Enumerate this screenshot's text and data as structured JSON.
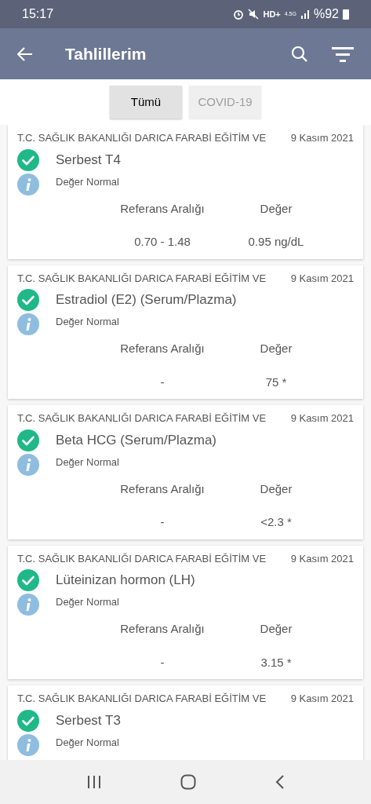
{
  "status_bar": {
    "time": "15:17",
    "network": "HD+",
    "network_gen": "4.5G",
    "battery": "%92"
  },
  "app_bar": {
    "title": "Tahlillerim"
  },
  "tabs": [
    {
      "label": "Tümü",
      "selected": true
    },
    {
      "label": "COVID-19",
      "selected": false
    }
  ],
  "results": [
    {
      "institution": "T.C. SAĞLIK BAKANLIĞI DARICA FARABİ EĞİTİM VE",
      "date": "9 Kasım 2021",
      "test": "Serbest T4",
      "status": "Değer Normal",
      "range_label": "Referans Aralığı",
      "value_label": "Değer",
      "range": "0.70 - 1.48",
      "value": "0.95 ng/dL"
    },
    {
      "institution": "T.C. SAĞLIK BAKANLIĞI DARICA FARABİ EĞİTİM VE",
      "date": "9 Kasım 2021",
      "test": "Estradiol (E2) (Serum/Plazma)",
      "status": "Değer Normal",
      "range_label": "Referans Aralığı",
      "value_label": "Değer",
      "range": "-",
      "value": "75 *"
    },
    {
      "institution": "T.C. SAĞLIK BAKANLIĞI DARICA FARABİ EĞİTİM VE",
      "date": "9 Kasım 2021",
      "test": "Beta HCG (Serum/Plazma)",
      "status": "Değer Normal",
      "range_label": "Referans Aralığı",
      "value_label": "Değer",
      "range": "-",
      "value": "<2.3 *"
    },
    {
      "institution": "T.C. SAĞLIK BAKANLIĞI DARICA FARABİ EĞİTİM VE",
      "date": "9 Kasım 2021",
      "test": "Lüteinizan hormon (LH)",
      "status": "Değer Normal",
      "range_label": "Referans Aralığı",
      "value_label": "Değer",
      "range": "-",
      "value": "3.15 *"
    },
    {
      "institution": "T.C. SAĞLIK BAKANLIĞI DARICA FARABİ EĞİTİM VE",
      "date": "9 Kasım 2021",
      "test": "Serbest T3",
      "status": "Değer Normal"
    }
  ]
}
